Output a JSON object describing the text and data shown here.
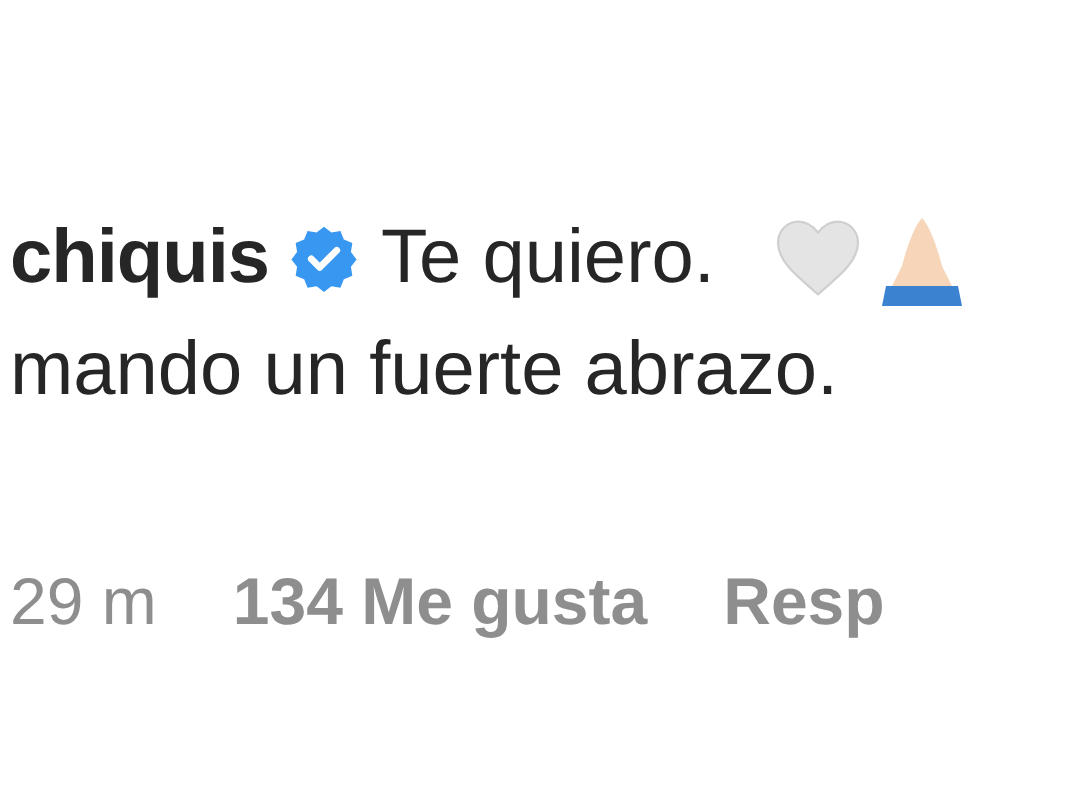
{
  "comment": {
    "username": "chiquis",
    "verified": true,
    "line_1": "Te quiero.",
    "line_2": "mando un fuerte abrazo."
  },
  "footer": {
    "time": "29 m",
    "likes": "134 Me gusta",
    "reply": "Resp"
  }
}
